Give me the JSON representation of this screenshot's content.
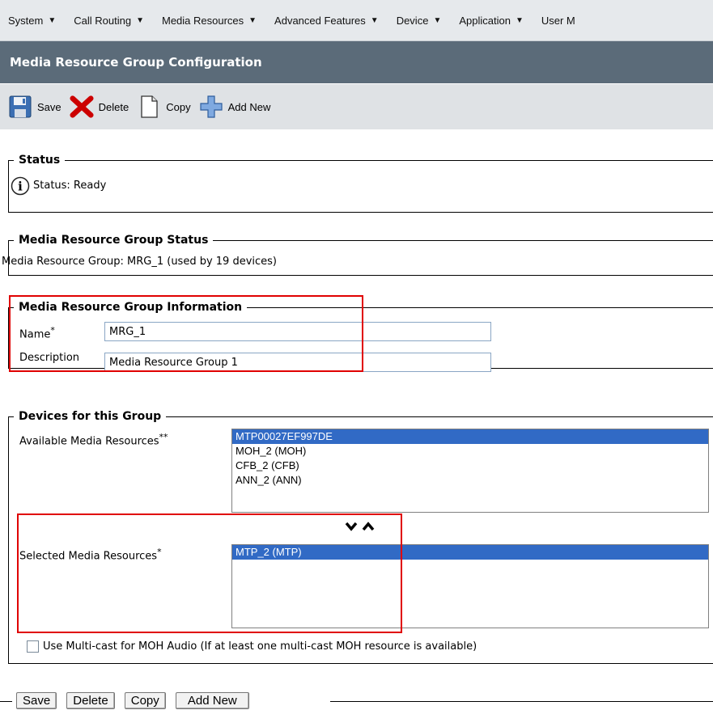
{
  "menu": {
    "items": [
      "System",
      "Call Routing",
      "Media Resources",
      "Advanced Features",
      "Device",
      "Application",
      "User M"
    ]
  },
  "title": "Media Resource Group Configuration",
  "toolbar": {
    "save": "Save",
    "delete": "Delete",
    "copy": "Copy",
    "add_new": "Add New"
  },
  "status": {
    "legend": "Status",
    "text": "Status: Ready"
  },
  "group_status": {
    "legend": "Media Resource Group Status",
    "text": "Media Resource Group: MRG_1 (used by 19 devices)"
  },
  "group_info": {
    "legend": "Media Resource Group Information",
    "name_label": "Name",
    "name_value": "MRG_1",
    "description_label": "Description",
    "description_value": "Media Resource Group 1",
    "required_mark": "*"
  },
  "devices": {
    "legend": "Devices for this Group",
    "available_label": "Available Media Resources",
    "available_mark": "**",
    "available_options": [
      "MTP00027EF997DE",
      "MOH_2 (MOH)",
      "CFB_2 (CFB)",
      "ANN_2 (ANN)"
    ],
    "available_selected_index": 0,
    "selected_label": "Selected Media Resources",
    "selected_mark": "*",
    "selected_options": [
      "MTP_2 (MTP)"
    ],
    "multicast_label": "Use Multi-cast for MOH Audio (If at least one multi-cast MOH resource is available)",
    "multicast_checked": false
  },
  "bottom_buttons": {
    "save": "Save",
    "delete": "Delete",
    "copy": "Copy",
    "add_new": "Add New"
  },
  "colors": {
    "title_bar": "#5b6b79",
    "highlight": "#e00000",
    "selection": "#316ac5"
  }
}
